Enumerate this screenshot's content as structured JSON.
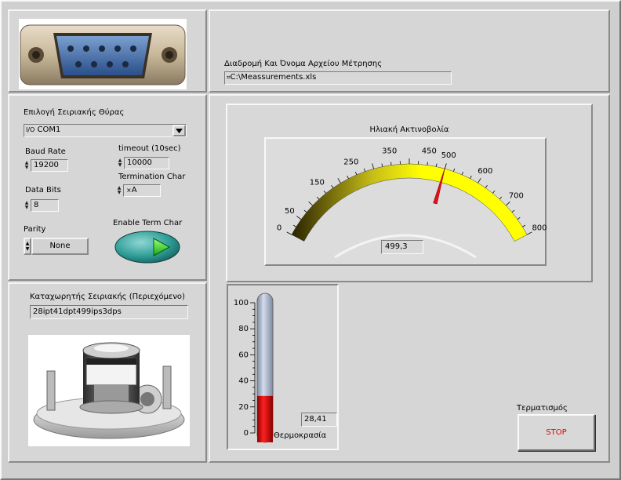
{
  "left_panel": {
    "port_label": "Επιλογή Σειριακής Θύρας",
    "port_value": "COM1",
    "baud_label": "Baud Rate",
    "baud_value": "19200",
    "timeout_label": "timeout (10sec)",
    "timeout_value": "10000",
    "term_char_label": "Termination Char",
    "term_char_value": "A",
    "databits_label": "Data Bits",
    "databits_value": "8",
    "parity_label": "Parity",
    "parity_value": "None",
    "enable_term_label": "Enable Term Char",
    "serial_buffer_label": "Καταχωρητής Σειριακής (Περιεχόμενο)",
    "serial_buffer_value": "28ipt41dpt499ips3dps"
  },
  "file": {
    "label": "Διαδρομή Και Όνομα Αρχείου Μέτρησης",
    "path": "C:\\Meassurements.xls"
  },
  "gauge": {
    "title": "Ηλιακή Ακτινοβολία",
    "value": 499.3,
    "display": "499,3",
    "min": 0,
    "max": 800,
    "ticks": [
      "0",
      "50",
      "150",
      "250",
      "350",
      "450",
      "500",
      "600",
      "700",
      "800"
    ],
    "tick_values": [
      0,
      50,
      150,
      250,
      350,
      450,
      500,
      600,
      700,
      800
    ]
  },
  "thermometer": {
    "label": "Θερμοκρασία",
    "value": 28.41,
    "display": "28,41",
    "min": 0,
    "max": 100,
    "ticks": [
      "100",
      "80",
      "60",
      "40",
      "20",
      "0"
    ]
  },
  "stop": {
    "label": "Τερματισμός",
    "button": "STOP"
  },
  "colors": {
    "gauge_low": "#2a2200",
    "gauge_high": "#ffff00",
    "needle": "#e0101a",
    "thermo_fill": "#e00000",
    "thermo_tube": "#b8c2d6",
    "led": "#22cc22",
    "stop_text": "#e00000"
  }
}
